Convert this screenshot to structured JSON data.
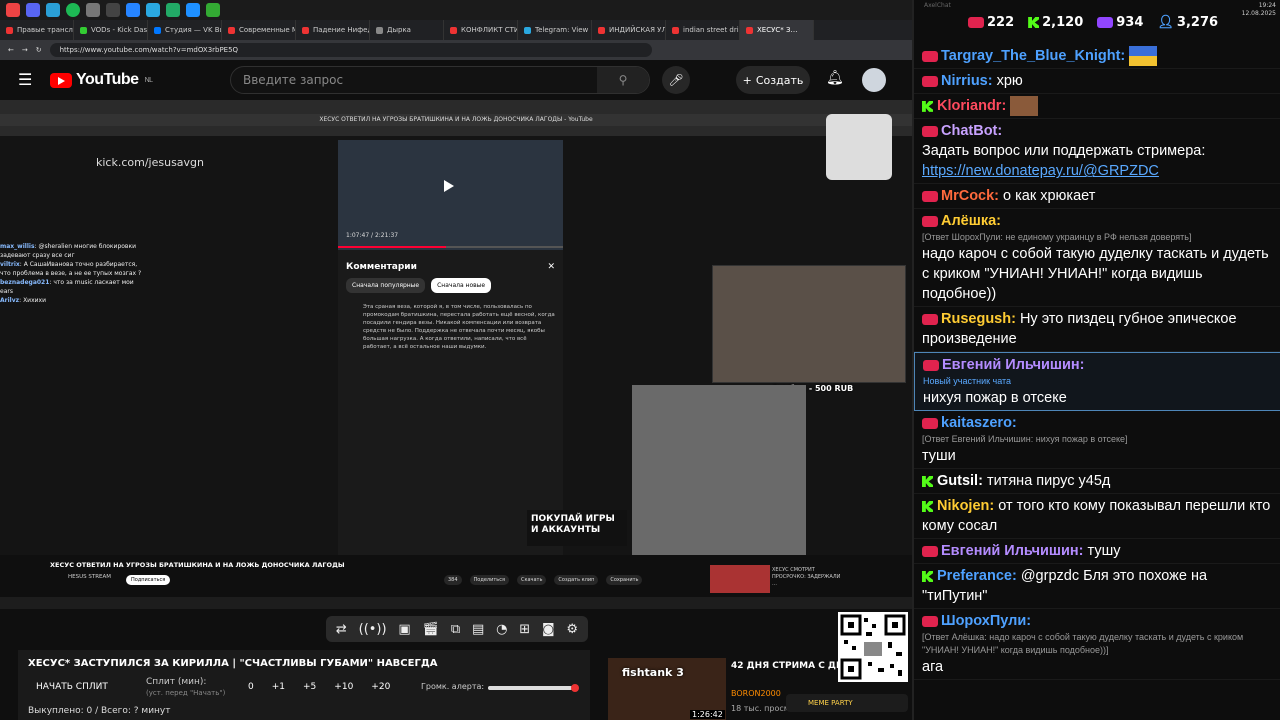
{
  "browser": {
    "tabs": [
      "Правые трансля…",
      "VODs - Kick Dash…",
      "Студия — VK Вид…",
      "Современные М…",
      "Падение Нифедо…",
      "Дырка",
      "КОНФЛИКТ СТИ…",
      "Telegram: View @…",
      "ИНДИЙСКАЯ УЛ…",
      "indian street drink…",
      "ХЕСУС* З…"
    ],
    "url": "https://www.youtube.com/watch?v=mdOX3rbPE5Q"
  },
  "youtube": {
    "logo": "YouTube",
    "region": "NL",
    "search_placeholder": "Введите запрос",
    "create_label": "Создать"
  },
  "stream": {
    "inner_title": "ХЕСУС ОТВЕТИЛ НА УГРОЗЫ БРАТИШКИНА И НА ЛОЖЬ ДОНОСЧИКА ЛАГОДЫ - YouTube",
    "kick_url": "kick.com/jesusavgn",
    "left_chat": [
      {
        "user": "max_willis",
        "text": "@sheralien многие блокировки задевают сразу все сиг"
      },
      {
        "user": "viltrix",
        "text": "А СашаИванова точно разбирается, что проблема в везе, а не ее тупых мозгах ?"
      },
      {
        "user": "beznadega021",
        "text": "что за music ласкает мои ears"
      },
      {
        "user": "Arilvz",
        "text": "Хихихи"
      }
    ],
    "player_time": "1:07:47 / 2:21:37",
    "comments_title": "Комментарии",
    "chip_popular": "Сначала популярные",
    "chip_new": "Сначала новые",
    "comment_text": "Эта сраная веза, которой я, в том числе, пользовалась по промокодам братишкина, перестала работать ещё весной, когда посадили гендира везы. Никакой компенсации или возврата средств не было. Поддержка не отвечала почти месяц, якобы большая нагрузка. А когда ответили, написали, что всё работает, а всё остальное наши выдумки.",
    "donation": "Алибек - 500 RUB",
    "promo": "ПОКУПАЙ ИГРЫ И АККАУНТЫ",
    "video_title": "ХЕСУС ОТВЕТИЛ НА УГРОЗЫ БРАТИШКИНА И НА ЛОЖЬ ДОНОСЧИКА ЛАГОДЫ",
    "channel": "HESUS STREAM",
    "subscribe": "Подписаться",
    "actions": [
      "384",
      "Поделиться",
      "Скачать",
      "Создать клип",
      "Сохранить"
    ],
    "related_title": "ХЕСУС СМОТРИТ ПРОСРОЧКО: ЗАДЕРЖАЛИ …"
  },
  "controls": {
    "icons": [
      "repeat-icon",
      "broadcast-icon",
      "camera-icon",
      "clapper-icon",
      "frame-icon",
      "film-icon",
      "speed-icon",
      "plus-box-icon",
      "photo-icon",
      "settings-icon"
    ]
  },
  "lower": {
    "title": "ХЕСУС* ЗАСТУПИЛСЯ ЗА КИРИЛЛА | \"СЧАСТЛИВЫ ГУБАМИ\" НАВСЕГДА",
    "split_label": "НАЧАТЬ СПЛИТ",
    "minutes_label": "Сплит (мин):",
    "minutes_sub": "(уст. перед \"Начать\")",
    "minutes_value": "0",
    "increments": [
      "+1",
      "+5",
      "+10",
      "+20"
    ],
    "alert_label": "Громк. алерта:",
    "alert_volume": 0.95,
    "bought": "Выкуплено: 0 / Всего: ? минут"
  },
  "recommendation": {
    "thumb_text": "fishtank 3",
    "duration": "1:26:42",
    "title": "42 ДНЯ СТРИМА С ДВО… ДНОМ - fishtank 3",
    "channel": "BORON2000",
    "views": "18 тыс. просм…",
    "notice": "MEME PARTY"
  },
  "chat": {
    "sys_label": "AxelChat",
    "clock_time": "19:24",
    "clock_date": "12.08.2025",
    "stats": [
      {
        "icon": "youtube-icon",
        "value": "222",
        "color": "#e0234e"
      },
      {
        "icon": "kick-icon",
        "value": "2,120",
        "color": "#53fc18"
      },
      {
        "icon": "twitch-icon",
        "value": "934",
        "color": "#9146ff"
      },
      {
        "icon": "viewers-icon",
        "value": "3,276",
        "color": "#4ea1ff"
      }
    ],
    "messages": [
      {
        "platform": "youtube",
        "user": "Targray_The_Blue_Knight:",
        "color": "#4ea1ff",
        "text": "",
        "reply": "",
        "extra": "flag"
      },
      {
        "platform": "youtube",
        "user": "Nirrius:",
        "color": "#4ea1ff",
        "text": "хрю",
        "reply": "",
        "extra": ""
      },
      {
        "platform": "kick",
        "user": "Kloriandr:",
        "color": "#ff4a5e",
        "text": "",
        "reply": "",
        "extra": "emote"
      },
      {
        "platform": "youtube",
        "user": "ChatBot:",
        "color": "#c8a2ff",
        "text": "Задать вопрос или поддержать стримера:",
        "link": "https://new.donatepay.ru/@GRPZDC",
        "reply": "",
        "extra": ""
      },
      {
        "platform": "youtube",
        "user": "MrCock:",
        "color": "#ff6a3d",
        "text": "о как хрюкает",
        "reply": "",
        "extra": ""
      },
      {
        "platform": "youtube",
        "user": "Алёшка:",
        "color": "#ffcc33",
        "text": "надо кароч с собой такую дуделку таскать и дудеть с криком \"УНИАН! УНИАН!\" когда видишь подобное))",
        "reply": "[Ответ ШорохПули: не единому украинцу в РФ нельзя доверять]",
        "extra": ""
      },
      {
        "platform": "youtube",
        "user": "Rusegush:",
        "color": "#ffcc33",
        "text": "Ну это пиздец губное эпическое произведение",
        "reply": "",
        "extra": ""
      },
      {
        "platform": "youtube",
        "user": "Евгений Ильчишин:",
        "color": "#b48cff",
        "text": "нихуя пожар в отсеке",
        "reply": "Новый участник чата",
        "extra": "highlight"
      },
      {
        "platform": "youtube",
        "user": "kaitaszero:",
        "color": "#4ea1ff",
        "text": "туши",
        "reply": "[Ответ Евгений Ильчишин: нихуя пожар в отсеке]",
        "extra": ""
      },
      {
        "platform": "kick",
        "user": "Gutsil:",
        "color": "#fff",
        "text": "титяна пирус у45д",
        "reply": "",
        "extra": ""
      },
      {
        "platform": "kick",
        "user": "Nikojen:",
        "color": "#ffcc33",
        "text": "от того кто кому показывал перешли кто кому сосал",
        "reply": "",
        "extra": ""
      },
      {
        "platform": "youtube",
        "user": "Евгений Ильчишин:",
        "color": "#b48cff",
        "text": "тушу",
        "reply": "",
        "extra": ""
      },
      {
        "platform": "kick",
        "user": "Preferance:",
        "color": "#4ea1ff",
        "text": "@grpzdc Бля это похоже на \"тиПутин\"",
        "reply": "",
        "extra": ""
      },
      {
        "platform": "youtube",
        "user": "ШорохПули:",
        "color": "#4ea1ff",
        "text": "ага",
        "reply": "[Ответ Алёшка: надо кароч с собой такую дуделку таскать и дудеть с криком \"УНИАН! УНИАН!\" когда видишь подобное))]",
        "extra": ""
      }
    ]
  }
}
